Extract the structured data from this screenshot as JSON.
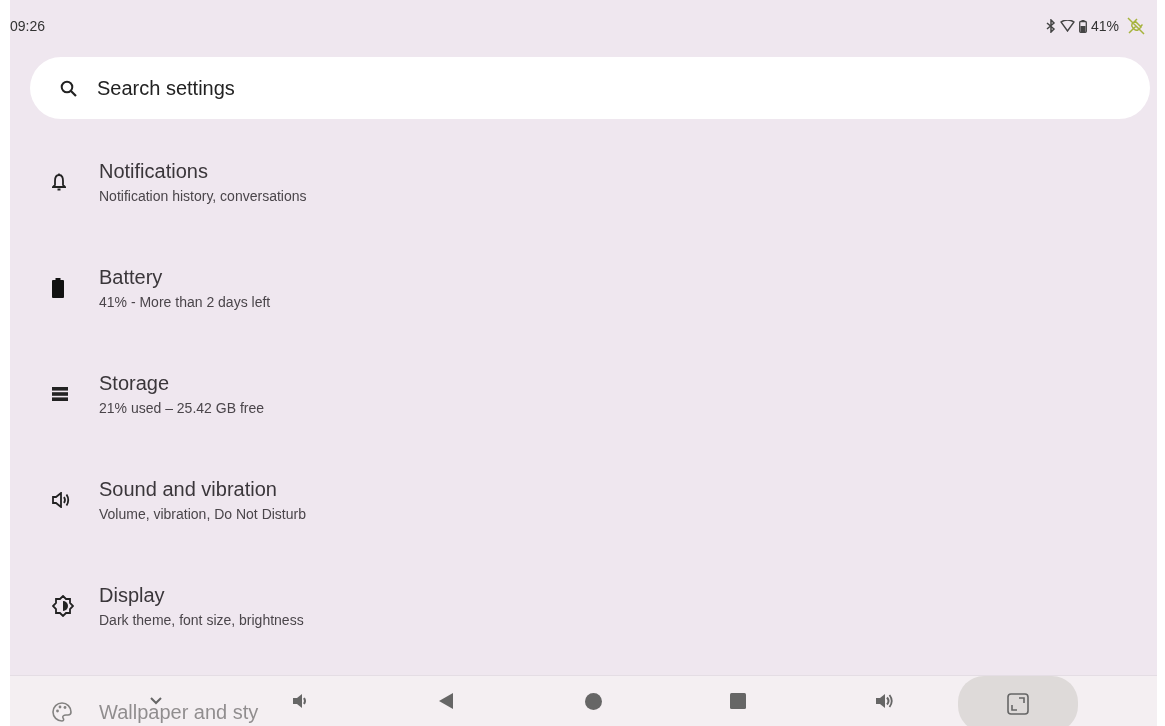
{
  "status_bar": {
    "time": "09:26",
    "battery_percent": "41%"
  },
  "search": {
    "placeholder": "Search settings"
  },
  "items": [
    {
      "title": "Notifications",
      "subtitle": "Notification history, conversations"
    },
    {
      "title": "Battery",
      "subtitle": "41% - More than 2 days left"
    },
    {
      "title": "Storage",
      "subtitle": "21% used – 25.42 GB free"
    },
    {
      "title": "Sound and vibration",
      "subtitle": "Volume, vibration, Do Not Disturb"
    },
    {
      "title": "Display",
      "subtitle": "Dark theme, font size, brightness"
    },
    {
      "title": "Wallpaper and sty"
    }
  ]
}
